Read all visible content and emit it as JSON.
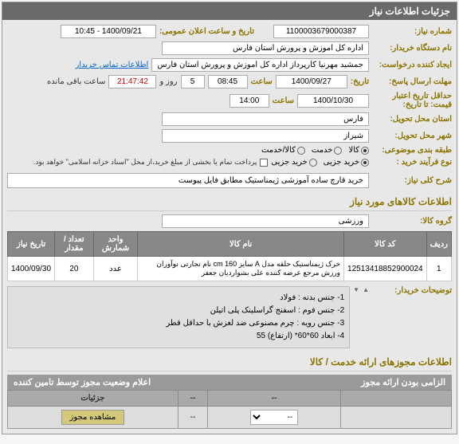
{
  "header": {
    "title": "جزئیات اطلاعات نیاز"
  },
  "fields": {
    "need_no_label": "شماره نیاز:",
    "need_no": "1100003679000387",
    "announce_label": "تاریخ و ساعت اعلان عمومی:",
    "announce_val": "1400/09/21 - 10:45",
    "buyer_label": "نام دستگاه خریدار:",
    "buyer_val": "اداره کل اموزش و پرورش استان فارس",
    "creator_label": "ایجاد کننده درخواست:",
    "creator_val": "جمشید مهرنیا کارپرداز اداره کل اموزش و پرورش استان فارس",
    "contact_link": "اطلاعات تماس خریدار",
    "deadline_label": "مهلت ارسال پاسخ:",
    "date_lbl": "تاریخ:",
    "deadline_date": "1400/09/27",
    "time_lbl": "ساعت",
    "deadline_time": "08:45",
    "days_remain": "5",
    "days_lbl": "روز و",
    "time_remain": "21:47:42",
    "remain_lbl": "ساعت باقی مانده",
    "credit_label": "حداقل تاریخ اعتبار",
    "price_label": "قیمت: تا تاریخ:",
    "credit_date": "1400/10/30",
    "credit_time": "14:00",
    "province_label": "استان محل تحویل:",
    "province_val": "فارس",
    "city_label": "شهر محل تحویل:",
    "city_val": "شیراز",
    "category_label": "طبقه بندی موضوعی:",
    "cat_goods": "کالا",
    "cat_service": "خدمت",
    "cat_both": "کالا/خدمت",
    "process_label": "نوع فرآیند خرید :",
    "proc_opt1": "خرید جزیی",
    "proc_opt2": "خرید جزیی",
    "proc_note": "پرداخت تمام یا بخشی از مبلغ خرید،از محل \"اسناد خزانه اسلامی\" خواهد بود.",
    "desc_label": "شرح کلی نیاز:",
    "desc_val": "خرید قارچ ساده آموزشی ژیمناستیک مطابق فایل پیوست"
  },
  "items_section": {
    "title": "اطلاعات کالاهای مورد نیاز",
    "group_label": "گروه کالا:",
    "group_val": "ورزشی",
    "columns": {
      "row": "ردیف",
      "code": "کد کالا",
      "name": "نام کالا",
      "unit": "واحد شمارش",
      "qty": "تعداد / مقدار",
      "date": "تاریخ نیاز"
    },
    "rows": [
      {
        "row": "1",
        "code": "12513418852900024",
        "name": "خرک ژیمناستیک حلقه مدل A سایز 160 cm نام تجارتی نوآوران ورزش مرجع عرضه کننده علی بشواردیان جعفر",
        "unit": "عدد",
        "qty": "20",
        "date": "1400/09/30"
      }
    ],
    "notes_label": "توضیحات خریدار:",
    "notes": [
      "1- جنس بدنه : فولاد",
      "2- جنس فوم : اسفنج گراسلینک پلی اتیلن",
      "3- جنس رویه : چرم مصنوعی ضد لغزش با حداقل قطر",
      "4- ابعاد 60*60* (ارتفاع) 55"
    ]
  },
  "permits_section": {
    "title": "اطلاعات مجوزهای ارائه خدمت / کالا",
    "sub_header_right": "الزامی بودن ارائه مجوز",
    "sub_header_left": "اعلام وضعیت مجوز توسط تامین کننده",
    "col1": "--",
    "col2": "--",
    "col3": "جزئیات",
    "btn": "مشاهده مجوز",
    "dash": "--"
  }
}
